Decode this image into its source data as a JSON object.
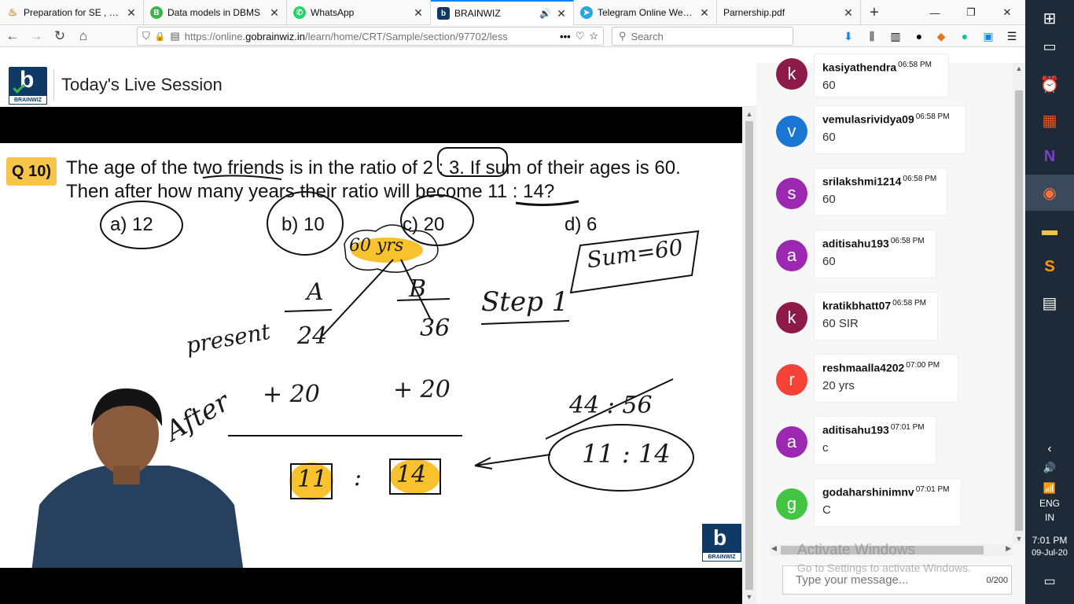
{
  "tabs": [
    {
      "title": "Preparation for SE , SES",
      "favicon": "lamp-icon",
      "color": "#e8b84a"
    },
    {
      "title": "Data models in DBMS",
      "favicon": "B",
      "color": "#3bb54a"
    },
    {
      "title": "WhatsApp",
      "favicon": "whatsapp-icon",
      "color": "#25d366"
    },
    {
      "title": "BRAINWIZ",
      "favicon": "b",
      "color": "#0f3a66"
    },
    {
      "title": "Telegram Online Web V",
      "favicon": "telegram-icon",
      "color": "#2ca5e0"
    },
    {
      "title": "Parnership.pdf",
      "favicon": "",
      "color": ""
    }
  ],
  "nav": {
    "url_prefix": "https://online.",
    "url_domain": "gobrainwiz.in",
    "url_path": "/learn/home/CRT/Sample/section/97702/less",
    "search_placeholder": "Search"
  },
  "header": {
    "brand": "BRAINWIZ",
    "title": "Today's Live Session"
  },
  "question": {
    "number": "Q 10)",
    "line1": "The age of the two friends is in the ratio of 2 : 3. If sum of their ages is 60.",
    "line2": "Then after how many years their ratio will become 11 : 14?",
    "options": [
      "a) 12",
      "b) 10",
      "c) 20",
      "d) 6"
    ]
  },
  "annotations": {
    "cloud": "60 yrs",
    "sum": "Sum=60",
    "a_label": "A",
    "b_label": "B",
    "step": "Step 1",
    "present": "present",
    "a_val": "24",
    "b_val": "36",
    "after": "After",
    "plus_a": "+ 20",
    "plus_b": "+ 20",
    "struck": "44 : 56",
    "ratio_circle": "11 : 14",
    "res_a": "11",
    "colon": ":",
    "res_b": "14"
  },
  "chat": {
    "messages": [
      {
        "initial": "k",
        "color": "#8e1a4a",
        "user": "kasiyathendra",
        "time": "06:58 PM",
        "text": "60"
      },
      {
        "initial": "v",
        "color": "#1976d2",
        "user": "vemulasrividya09",
        "time": "06:58 PM",
        "text": "60"
      },
      {
        "initial": "s",
        "color": "#9c27b0",
        "user": "srilakshmi1214",
        "time": "06:58 PM",
        "text": "60"
      },
      {
        "initial": "a",
        "color": "#9c27b0",
        "user": "aditisahu193",
        "time": "06:58 PM",
        "text": "60"
      },
      {
        "initial": "k",
        "color": "#8e1a4a",
        "user": "kratikbhatt07",
        "time": "06:58 PM",
        "text": "60 SIR"
      },
      {
        "initial": "r",
        "color": "#f44336",
        "user": "reshmaalla4202",
        "time": "07:00 PM",
        "text": "20 yrs"
      },
      {
        "initial": "a",
        "color": "#9c27b0",
        "user": "aditisahu193",
        "time": "07:01 PM",
        "text": "c"
      },
      {
        "initial": "g",
        "color": "#43c443",
        "user": "godaharshinimnv",
        "time": "07:01 PM",
        "text": "C"
      }
    ],
    "input_placeholder": "Type your message...",
    "char_count": "0/200",
    "watermark_title": "Activate Windows",
    "watermark_sub": "Go to Settings to activate Windows."
  },
  "taskbar": {
    "lang": "ENG",
    "region": "IN",
    "time": "7:01 PM",
    "date": "09-Jul-20"
  }
}
